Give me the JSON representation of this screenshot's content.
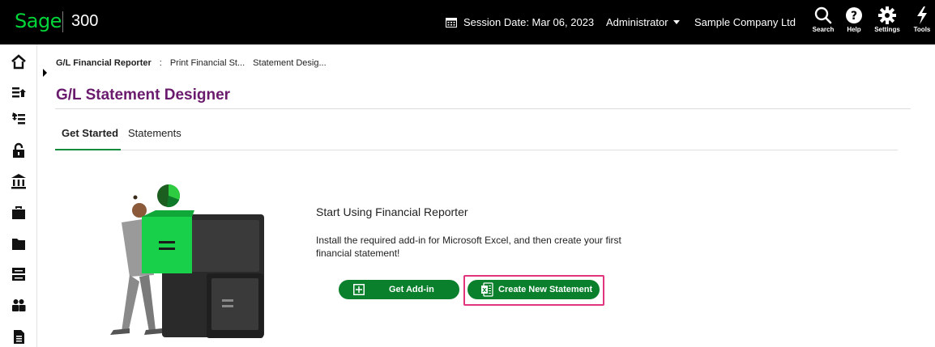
{
  "header": {
    "brand": "Sage",
    "product": "300",
    "session_date": "Session Date: Mar 06, 2023",
    "user": "Administrator",
    "company": "Sample Company Ltd",
    "tools": [
      {
        "label": "Search",
        "icon": "search-icon"
      },
      {
        "label": "Help",
        "icon": "help-icon"
      },
      {
        "label": "Settings",
        "icon": "gear-icon"
      },
      {
        "label": "Tools",
        "icon": "lightning-icon"
      }
    ]
  },
  "sidebar": {
    "icons": [
      "home-icon",
      "export-icon",
      "import-icon",
      "lock-icon",
      "bank-icon",
      "briefcase-icon",
      "folder-icon",
      "server-icon",
      "people-icon",
      "document-icon"
    ]
  },
  "breadcrumb": {
    "root": "G/L Financial Reporter",
    "separator": ":",
    "item1": "Print Financial St...",
    "item2": "Statement Desig..."
  },
  "page": {
    "title": "G/L Statement Designer",
    "tabs": [
      {
        "label": "Get Started",
        "active": true
      },
      {
        "label": "Statements",
        "active": false
      }
    ]
  },
  "content": {
    "heading": "Start Using Financial Reporter",
    "body": "Install the required add-in for Microsoft Excel, and then create your first financial statement!",
    "get_addin_label": "Get Add-in",
    "create_statement_label": "Create New Statement"
  },
  "colors": {
    "brand_green": "#00d639",
    "button_green": "#0a7f2c",
    "title_purple": "#6b1b6e",
    "highlight_pink": "#e0347c"
  }
}
